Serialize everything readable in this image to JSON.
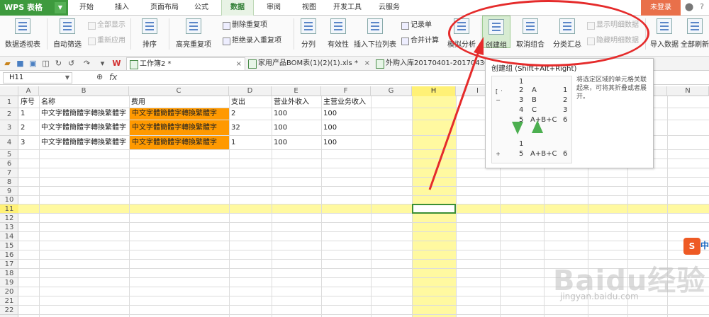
{
  "app": {
    "logo": "WPS 表格",
    "login": "未登录"
  },
  "menu_tabs": [
    "开始",
    "插入",
    "页面布局",
    "公式",
    "数据",
    "审阅",
    "视图",
    "开发工具",
    "云服务"
  ],
  "ribbon": {
    "pivot": "数据透视表",
    "autofilter": "自动筛选",
    "show_all": "全部显示",
    "reapply": "重新应用",
    "sort": "排序",
    "highlight_dup": "高亮重复项",
    "delete_dup": "删除重复项",
    "reject_dup": "拒绝录入重复项",
    "split": "分列",
    "validity": "有效性",
    "insert_dropdown": "插入下拉列表",
    "record_form": "记录单",
    "merge_calc": "合并计算",
    "simulate": "模拟分析",
    "create_group": "创建组",
    "ungroup": "取消组合",
    "subtotal": "分类汇总",
    "show_detail": "显示明细数据",
    "hide_detail": "隐藏明细数据",
    "import": "导入数据",
    "refresh_all": "全部刷新"
  },
  "doc_tabs": [
    {
      "label": "工作簿2 *"
    },
    {
      "label": "家用产品BOM表(1)(2)(1).xls *"
    },
    {
      "label": "外购入库20170401-20170430"
    }
  ],
  "formula_bar": {
    "cell_ref": "H11",
    "fx": "fx"
  },
  "columns": [
    "A",
    "B",
    "C",
    "D",
    "E",
    "F",
    "G",
    "H",
    "I",
    "J",
    "K",
    "L",
    "M",
    "N"
  ],
  "rows": [
    "1",
    "2",
    "3",
    "4",
    "5",
    "6",
    "7",
    "8",
    "9",
    "10",
    "11",
    "12",
    "13",
    "14",
    "15",
    "16",
    "17",
    "18",
    "19",
    "20",
    "21",
    "22"
  ],
  "sheet": {
    "headers": [
      "序号",
      "名称",
      "费用",
      "支出",
      "营业外收入",
      "主营业务收入"
    ],
    "data": [
      [
        "1",
        "中文字體簡體字轉換繁體字",
        "中文字體簡體字轉換繁體字",
        "2",
        "100",
        "100"
      ],
      [
        "2",
        "中文字體簡體字轉換繁體字",
        "中文字體簡體字轉換繁體字",
        "32",
        "100",
        "100"
      ],
      [
        "3",
        "中文字體簡體字轉換繁體字",
        "中文字體簡體字轉換繁體字",
        "1",
        "100",
        "100"
      ]
    ]
  },
  "tooltip": {
    "title": "创建组 (Shift+Alt+Right)",
    "desc": "将选定区域的单元格关联起来，可将其折叠或者展开。",
    "top_rows": [
      [
        "1",
        ""
      ],
      [
        "2",
        "A",
        "1"
      ],
      [
        "3",
        "B",
        "2"
      ],
      [
        "4",
        "C",
        "3"
      ],
      [
        "5",
        "A+B+C",
        "6"
      ]
    ],
    "bottom_rows": [
      [
        "1",
        ""
      ],
      [
        "5",
        "A+B+C",
        "6"
      ]
    ]
  },
  "watermark": {
    "brand": "Baidu经验",
    "url": "jingyan.baidu.com",
    "ime": "中"
  },
  "colors": {
    "accent_green": "#3e9a3e",
    "highlight_yellow": "#fff9a0",
    "orange_fill": "#ff9900",
    "circle_red": "#e52b2b",
    "login_orange": "#e9704a"
  }
}
